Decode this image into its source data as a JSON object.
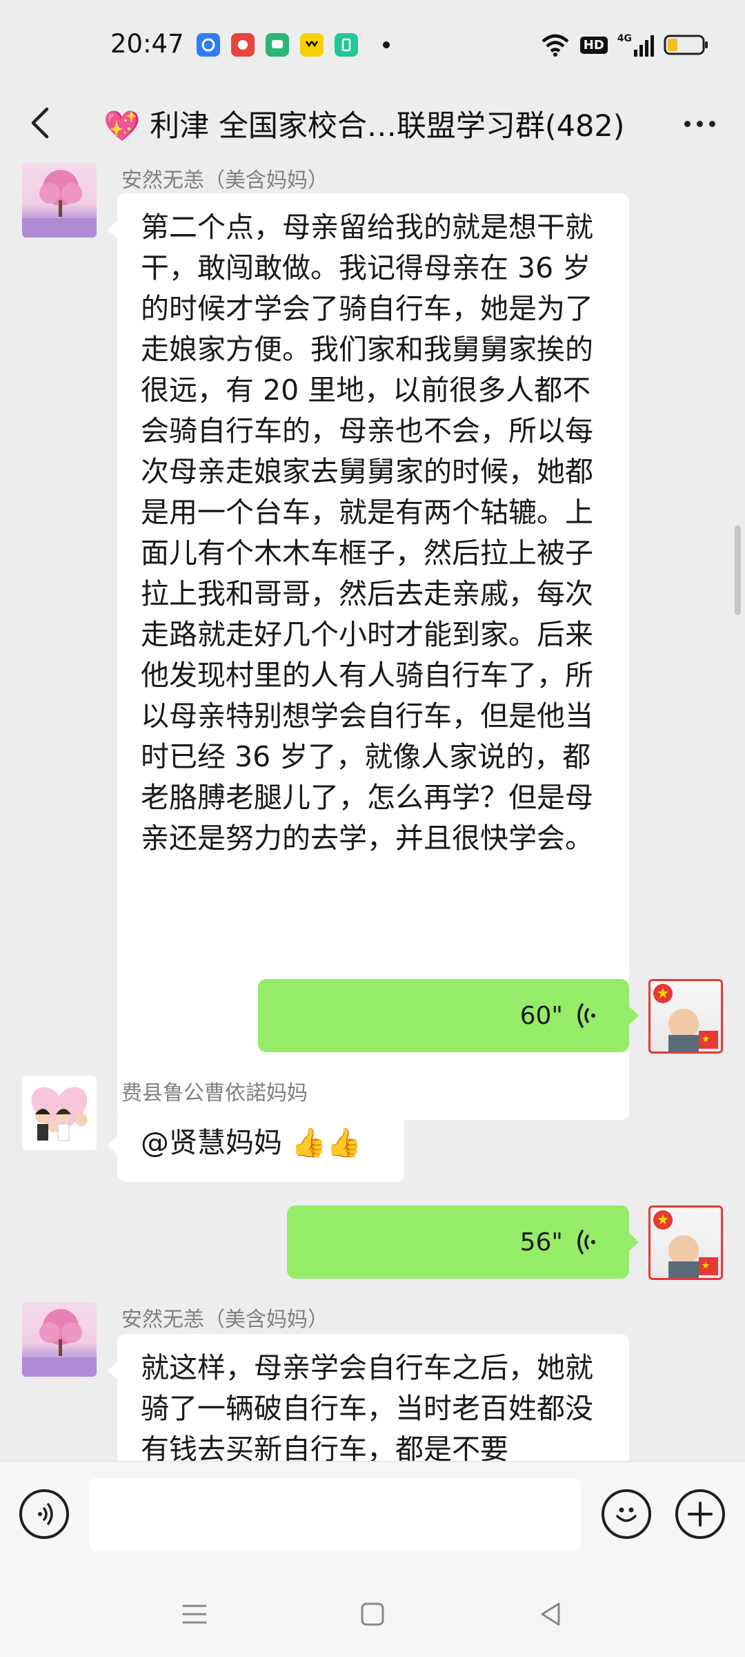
{
  "status_bar": {
    "time": "20:47",
    "apps": [
      {
        "icon": "browser-icon",
        "color": "#2f7df6"
      },
      {
        "icon": "app-red-icon",
        "color": "#e8453c"
      },
      {
        "icon": "message-icon",
        "color": "#2bb673"
      },
      {
        "icon": "yy-icon",
        "color": "#f5d000"
      },
      {
        "icon": "phone-manager-icon",
        "color": "#20c997"
      }
    ],
    "network_label": "HD",
    "network_type": "4G"
  },
  "header": {
    "title": "💖 利津 全国家校合…联盟学习群(482)"
  },
  "messages": [
    {
      "sender": "安然无恙（美含妈妈）",
      "text": "第二个点，母亲留给我的就是想干就干，敢闯敢做。我记得母亲在 36 岁的时候才学会了骑自行车，她是为了走娘家方便。我们家和我舅舅家挨的很远，有 20 里地，以前很多人都不会骑自行车的，母亲也不会，所以每次母亲走娘家去舅舅家的时候，她都是用一个台车，就是有两个轱辘。上面儿有个木木车框子，然后拉上被子拉上我和哥哥，然后去走亲戚，每次走路就走好几个小时才能到家。后来他发现村里的人有人骑自行车了，所以母亲特别想学会自行车，但是他当时已经 36 岁了，就像人家说的，都老胳膊老腿儿了，怎么再学？但是母亲还是努力的去学，并且很快学会。"
    },
    {
      "duration": "60\""
    },
    {
      "sender": "费县鲁公曹依諾妈妈",
      "text": "@贤慧妈妈 👍👍"
    },
    {
      "duration": "56\""
    },
    {
      "sender": "安然无恙（美含妈妈）",
      "text": "就这样，母亲学会自行车之后，她就骑了一辆破自行车，当时老百姓都没有钱去买新自行车，都是不要"
    }
  ],
  "colors": {
    "background": "#ededed",
    "own_bubble": "#95ec69",
    "other_bubble": "#ffffff"
  }
}
